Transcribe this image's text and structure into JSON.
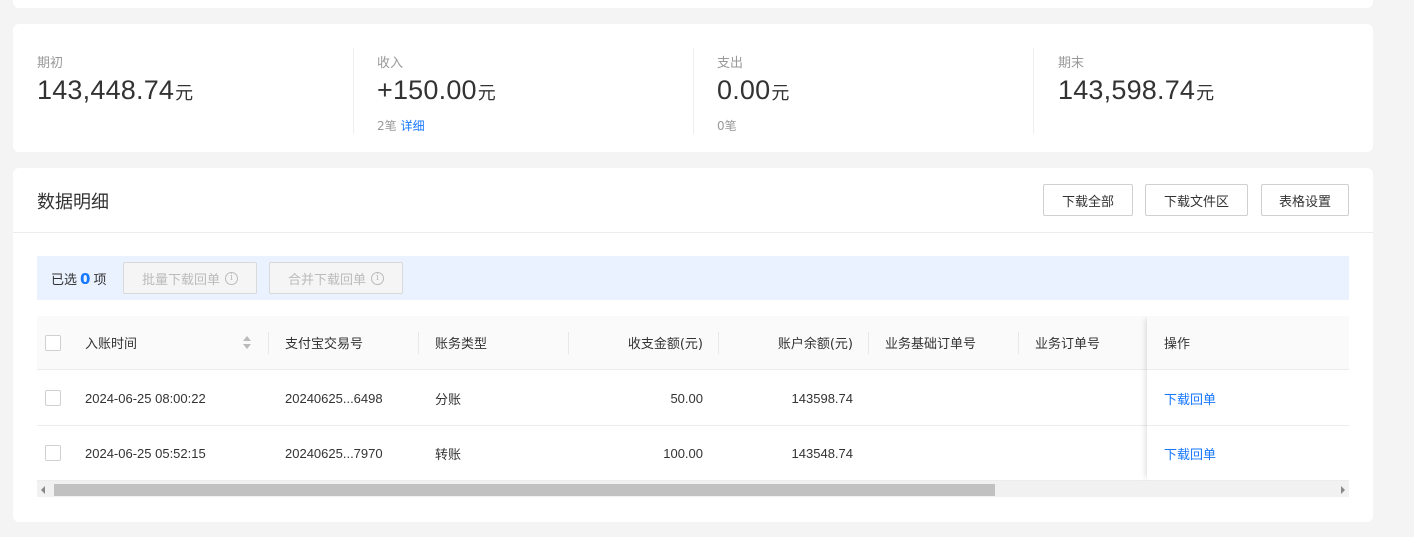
{
  "summary": {
    "opening": {
      "label": "期初",
      "amount": "143,448.74",
      "unit": "元"
    },
    "income": {
      "label": "收入",
      "amount": "+150.00",
      "unit": "元",
      "count": "2笔",
      "detail_link": "详细"
    },
    "expense": {
      "label": "支出",
      "amount": "0.00",
      "unit": "元",
      "count": "0笔"
    },
    "closing": {
      "label": "期末",
      "amount": "143,598.74",
      "unit": "元"
    }
  },
  "detail": {
    "title": "数据明细",
    "buttons": {
      "download_all": "下载全部",
      "download_files": "下载文件区",
      "table_settings": "表格设置"
    },
    "selection": {
      "prefix": "已选",
      "count": "0",
      "suffix": "项",
      "batch_download": "批量下载回单",
      "merge_download": "合并下载回单"
    },
    "columns": {
      "time": "入账时间",
      "trade_no": "支付宝交易号",
      "type": "账务类型",
      "amount": "收支金额(元)",
      "balance": "账户余额(元)",
      "base_order": "业务基础订单号",
      "order": "业务订单号",
      "action": "操作"
    },
    "rows": [
      {
        "time": "2024-06-25 08:00:22",
        "trade_no": "20240625...6498",
        "type": "分账",
        "amount": "50.00",
        "balance": "143598.74",
        "action": "下载回单"
      },
      {
        "time": "2024-06-25 05:52:15",
        "trade_no": "20240625...7970",
        "type": "转账",
        "amount": "100.00",
        "balance": "143548.74",
        "action": "下载回单"
      }
    ]
  },
  "colors": {
    "accent": "#1677ff",
    "select_bar": "#eaf2ff"
  }
}
